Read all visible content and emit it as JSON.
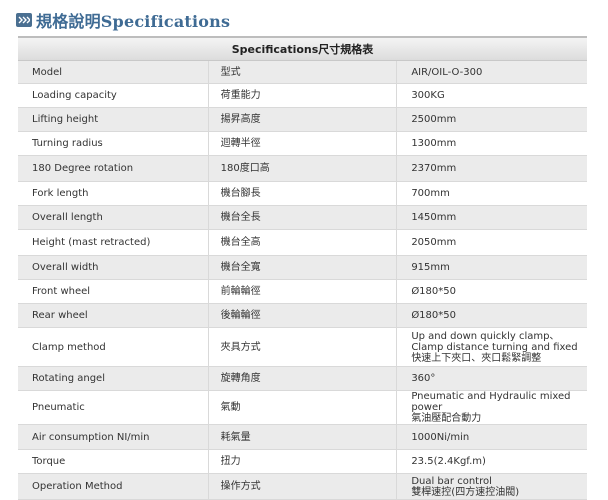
{
  "heading": {
    "title": "規格說明Specifications",
    "icon": "double-chevron-right-icon"
  },
  "table": {
    "title": "Specifications尺寸規格表",
    "rows": [
      {
        "label": "Model",
        "label_zh": "型式",
        "value": "AIR/OIL-O-300",
        "value_zh": ""
      },
      {
        "label": "Loading capacity",
        "label_zh": "荷重能力",
        "value": "300KG",
        "value_zh": ""
      },
      {
        "label": "Lifting height",
        "label_zh": "揚昇高度",
        "value": "2500mm",
        "value_zh": ""
      },
      {
        "label": "Turning radius",
        "label_zh": "迴轉半徑",
        "value": "1300mm",
        "value_zh": ""
      },
      {
        "label": "180 Degree rotation",
        "label_zh": "180度口高",
        "value": "2370mm",
        "value_zh": ""
      },
      {
        "label": "Fork length",
        "label_zh": "機台腳長",
        "value": "700mm",
        "value_zh": ""
      },
      {
        "label": "Overall length",
        "label_zh": "機台全長",
        "value": "1450mm",
        "value_zh": ""
      },
      {
        "label": "Height (mast retracted)",
        "label_zh": "機台全高",
        "value": "2050mm",
        "value_zh": ""
      },
      {
        "label": "Overall width",
        "label_zh": "機台全寬",
        "value": "915mm",
        "value_zh": ""
      },
      {
        "label": "Front wheel",
        "label_zh": "前輪輪徑",
        "value": "Ø180*50",
        "value_zh": ""
      },
      {
        "label": "Rear wheel",
        "label_zh": "後輪輪徑",
        "value": "Ø180*50",
        "value_zh": ""
      },
      {
        "label": "Clamp method",
        "label_zh": "夾具方式",
        "value": "Up and down quickly clamp、Clamp distance turning and fixed",
        "value_zh": "快速上下夾口、夾口鬆緊調整"
      },
      {
        "label": "Rotating angel",
        "label_zh": "旋轉角度",
        "value": "360°",
        "value_zh": ""
      },
      {
        "label": "Pneumatic",
        "label_zh": "氣動",
        "value": "Pneumatic and Hydraulic mixed power",
        "value_zh": "氣油壓配合動力"
      },
      {
        "label": "Air consumption NI/min",
        "label_zh": "耗氣量",
        "value": "1000Ni/min",
        "value_zh": ""
      },
      {
        "label": "Torque",
        "label_zh": "扭力",
        "value": "23.5(2.4Kgf.m)",
        "value_zh": ""
      },
      {
        "label": "Operation Method",
        "label_zh": "操作方式",
        "value": "Dual bar control",
        "value_zh": "雙桿速控(四方速控油閥)"
      }
    ]
  },
  "colors": {
    "heading_text": "#3f6b94",
    "row_shade": "#ebebeb",
    "border": "#d9d9d9"
  }
}
